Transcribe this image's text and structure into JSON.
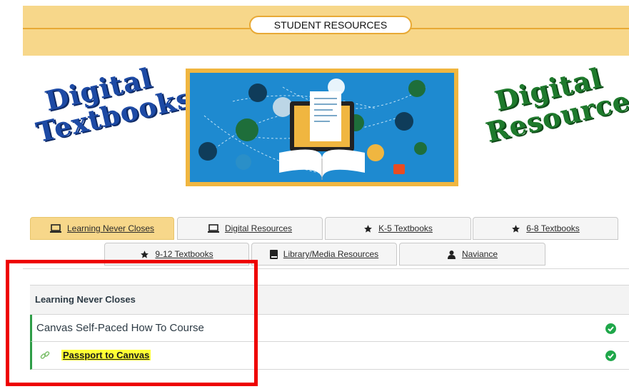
{
  "banner": {
    "title": "STUDENT RESOURCES"
  },
  "hero": {
    "left_text": [
      "Digital",
      "Textbooks"
    ],
    "right_text": [
      "Digital",
      "Resources"
    ]
  },
  "tabs": [
    {
      "label": "Learning Never Closes",
      "icon": "laptop-icon",
      "active": true
    },
    {
      "label": "Digital Resources",
      "icon": "laptop-icon",
      "active": false
    },
    {
      "label": "K-5 Textbooks",
      "icon": "star-icon",
      "active": false
    },
    {
      "label": "6-8 Textbooks",
      "icon": "star-icon",
      "active": false
    },
    {
      "label": "9-12 Textbooks",
      "icon": "star-icon",
      "active": false
    },
    {
      "label": "Library/Media Resources",
      "icon": "book-icon",
      "active": false
    },
    {
      "label": "Naviance",
      "icon": "user-icon",
      "active": false
    }
  ],
  "module": {
    "header": "Learning Never Closes",
    "items": [
      {
        "title": "Canvas Self-Paced How To Course",
        "type": "subheader",
        "completed": true
      },
      {
        "title": "Passport to Canvas",
        "type": "link",
        "icon": "link-icon",
        "completed": true
      }
    ]
  },
  "colors": {
    "accent": "#f7d78a",
    "border": "#e8a935",
    "success": "#1fa74a",
    "highlight": "#ee0000"
  }
}
